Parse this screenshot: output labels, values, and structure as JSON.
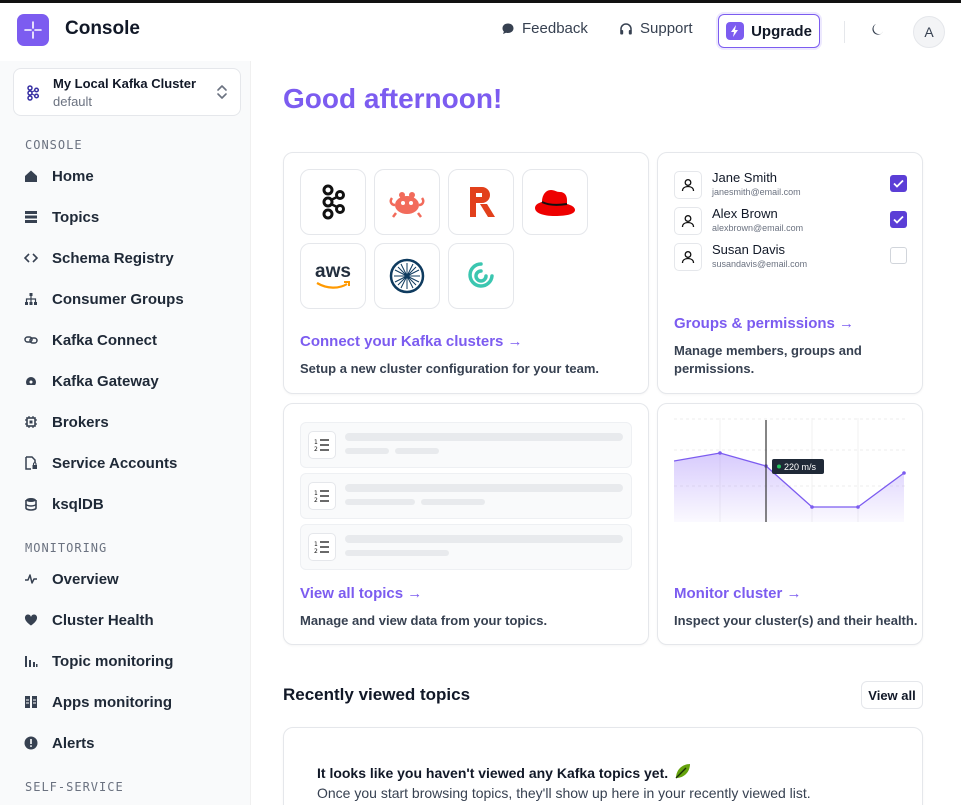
{
  "header": {
    "app_title": "Console",
    "feedback": "Feedback",
    "support": "Support",
    "upgrade": "Upgrade",
    "avatar_initial": "A"
  },
  "cluster": {
    "name": "My Local Kafka Cluster",
    "environment": "default"
  },
  "sidebar": {
    "console_label": "CONSOLE",
    "console_items": [
      {
        "label": "Home",
        "icon": "home-icon"
      },
      {
        "label": "Topics",
        "icon": "topics-icon"
      },
      {
        "label": "Schema Registry",
        "icon": "code-icon"
      },
      {
        "label": "Consumer Groups",
        "icon": "hierarchy-icon"
      },
      {
        "label": "Kafka Connect",
        "icon": "link-icon"
      },
      {
        "label": "Kafka Gateway",
        "icon": "gateway-icon"
      },
      {
        "label": "Brokers",
        "icon": "chip-icon"
      },
      {
        "label": "Service Accounts",
        "icon": "document-lock-icon"
      },
      {
        "label": "ksqlDB",
        "icon": "database-icon"
      }
    ],
    "monitoring_label": "MONITORING",
    "monitoring_items": [
      {
        "label": "Overview",
        "icon": "pulse-icon"
      },
      {
        "label": "Cluster Health",
        "icon": "heart-icon"
      },
      {
        "label": "Topic monitoring",
        "icon": "bar-chart-icon"
      },
      {
        "label": "Apps monitoring",
        "icon": "apps-icon"
      },
      {
        "label": "Alerts",
        "icon": "alert-icon"
      }
    ],
    "self_service_label": "SELF-SERVICE"
  },
  "main": {
    "greeting": "Good afternoon!",
    "connect_card": {
      "link": "Connect your Kafka clusters →",
      "desc": "Setup a new cluster configuration for your team.",
      "providers": [
        "kafka",
        "redpanda-crab",
        "redpanda-r",
        "redhat",
        "aws",
        "confluent",
        "aiven"
      ],
      "aws_text": "aws"
    },
    "groups_card": {
      "members": [
        {
          "name": "Jane Smith",
          "email": "janesmith@email.com",
          "checked": true
        },
        {
          "name": "Alex Brown",
          "email": "alexbrown@email.com",
          "checked": true
        },
        {
          "name": "Susan Davis",
          "email": "susandavis@email.com",
          "checked": false
        }
      ],
      "link": "Groups & permissions →",
      "desc": "Manage members, groups and permissions."
    },
    "topics_card": {
      "link": "View all topics →",
      "desc": "Manage and view data from your topics.",
      "row_icon_text": "1☰\n2"
    },
    "monitor_card": {
      "tooltip": "220 m/s",
      "link": "Monitor cluster →",
      "desc": "Inspect your cluster(s) and their health.",
      "accent": "#7c5cf0"
    },
    "recent": {
      "title": "Recently viewed topics",
      "view_all": "View all",
      "empty_title": "It looks like you haven't viewed any Kafka topics yet.",
      "empty_desc": "Once you start browsing topics, they'll show up here in your recently viewed list."
    }
  },
  "colors": {
    "accent": "#7c5cf0",
    "checkbox": "#5b3ed6"
  }
}
